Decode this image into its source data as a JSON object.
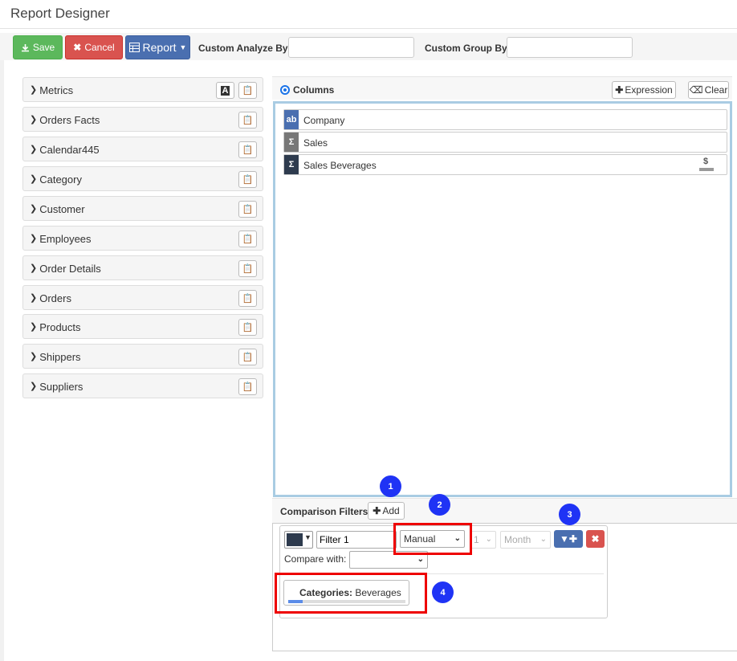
{
  "window": {
    "title": "Report Designer"
  },
  "toolbar": {
    "save_label": "Save",
    "cancel_label": "Cancel",
    "report_label": "Report",
    "analyze_label": "Custom Analyze By",
    "analyze_value": "",
    "group_label": "Custom Group By",
    "group_value": ""
  },
  "field_groups": [
    {
      "label": "Metrics"
    },
    {
      "label": "Orders Facts"
    },
    {
      "label": "Calendar445"
    },
    {
      "label": "Category"
    },
    {
      "label": "Customer"
    },
    {
      "label": "Employees"
    },
    {
      "label": "Order Details"
    },
    {
      "label": "Orders"
    },
    {
      "label": "Products"
    },
    {
      "label": "Shippers"
    },
    {
      "label": "Suppliers"
    }
  ],
  "columns": {
    "header": "Columns",
    "expression_label": "Expression",
    "clear_label": "Clear",
    "items": [
      {
        "name": "Company",
        "type": "ab",
        "color": "#4a6fb0"
      },
      {
        "name": "Sales",
        "type": "Σ",
        "color": "#777777"
      },
      {
        "name": "Sales Beverages",
        "type": "Σ",
        "color": "#2e3b4e"
      }
    ]
  },
  "comparison": {
    "header": "Comparison Filters",
    "add_label": "Add",
    "filter_name": "Filter 1",
    "mode": "Manual",
    "period_count": "1",
    "period_unit": "Month",
    "compare_label": "Compare with:",
    "compare_value": "",
    "category_label": "Categories:",
    "category_value": "Beverages"
  },
  "callouts": [
    "1",
    "2",
    "3",
    "4"
  ],
  "colors": {
    "accent": "#1f33f5",
    "highlight": "#e00000",
    "save": "#5cb85c",
    "cancel": "#d9534f",
    "report": "#4a6fb0"
  }
}
